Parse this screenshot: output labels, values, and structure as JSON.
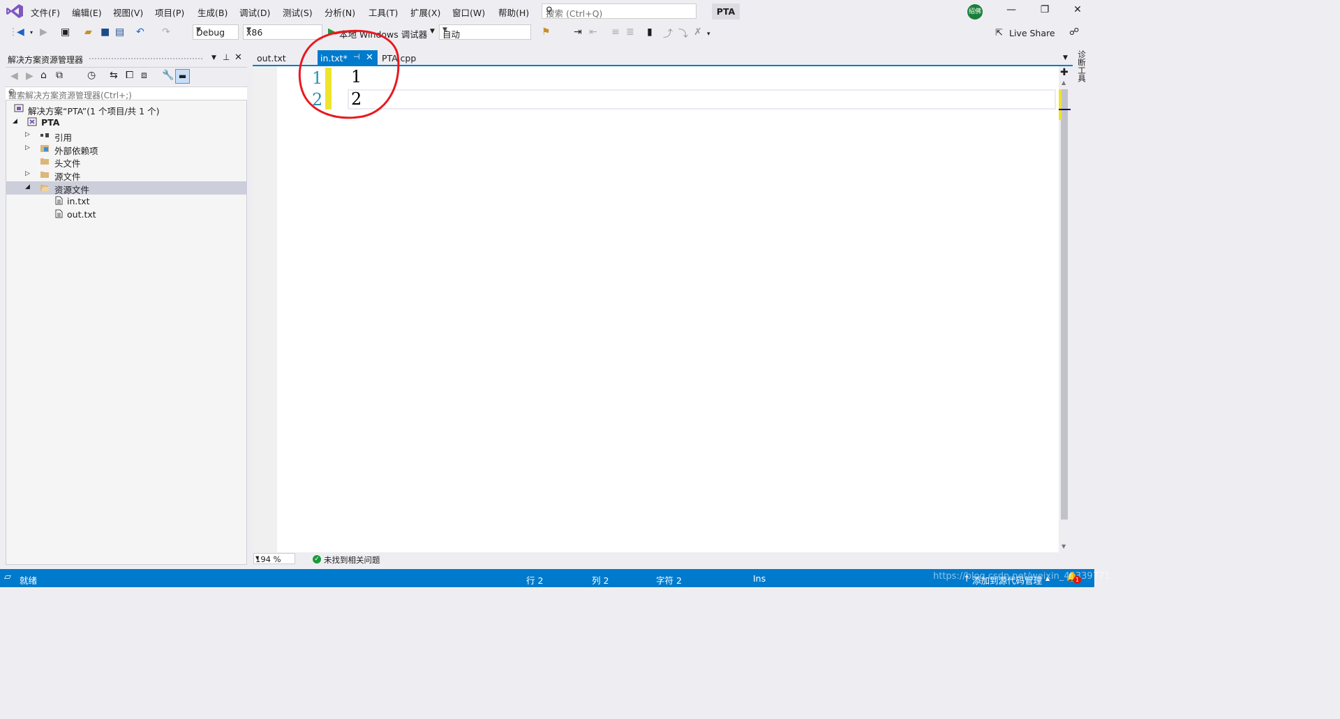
{
  "menu": {
    "items": [
      "文件(F)",
      "编辑(E)",
      "视图(V)",
      "项目(P)",
      "生成(B)",
      "调试(D)",
      "测试(S)",
      "分析(N)",
      "工具(T)",
      "扩展(X)",
      "窗口(W)",
      "帮助(H)"
    ],
    "search_placeholder": "搜索 (Ctrl+Q)",
    "solution_name": "PTA",
    "avatar_text": "绍佛"
  },
  "toolbar": {
    "config": "Debug",
    "platform": "x86",
    "run_label": "本地 Windows 调试器",
    "run_mode": "自动",
    "live_share": "Live Share"
  },
  "solution_explorer": {
    "title": "解决方案资源管理器",
    "search_placeholder": "搜索解决方案资源管理器(Ctrl+;)",
    "tree": [
      {
        "label": "解决方案“PTA”(1 个项目/共 1 个)",
        "icon": "solution-icon"
      },
      {
        "label": "PTA",
        "icon": "project-icon"
      },
      {
        "label": "引用",
        "icon": "references-icon"
      },
      {
        "label": "外部依赖项",
        "icon": "external-deps-icon"
      },
      {
        "label": "头文件",
        "icon": "folder-icon"
      },
      {
        "label": "源文件",
        "icon": "folder-icon"
      },
      {
        "label": "资源文件",
        "icon": "folder-open-icon"
      },
      {
        "label": "in.txt",
        "icon": "file-icon"
      },
      {
        "label": "out.txt",
        "icon": "file-icon"
      }
    ]
  },
  "tabs": {
    "out": "out.txt",
    "in": "in.txt*",
    "cpp": "PTA.cpp"
  },
  "editor": {
    "lines": [
      {
        "no": "1",
        "text": "1"
      },
      {
        "no": "2",
        "text": "2"
      }
    ],
    "zoom": "194 %",
    "issues": "未找到相关问题",
    "right_tool_label": "诊断工具"
  },
  "statusbar": {
    "ready": "就绪",
    "line": "行 2",
    "col": "列 2",
    "char": "字符 2",
    "mode": "Ins",
    "source_control": "添加到源代码管理",
    "watermark": "https://blog.csdn.net/weixin_45339771",
    "notification_count": "1"
  },
  "colors": {
    "accent": "#007acc",
    "annotation": "#e8181e",
    "change_bar": "#efe42c"
  }
}
